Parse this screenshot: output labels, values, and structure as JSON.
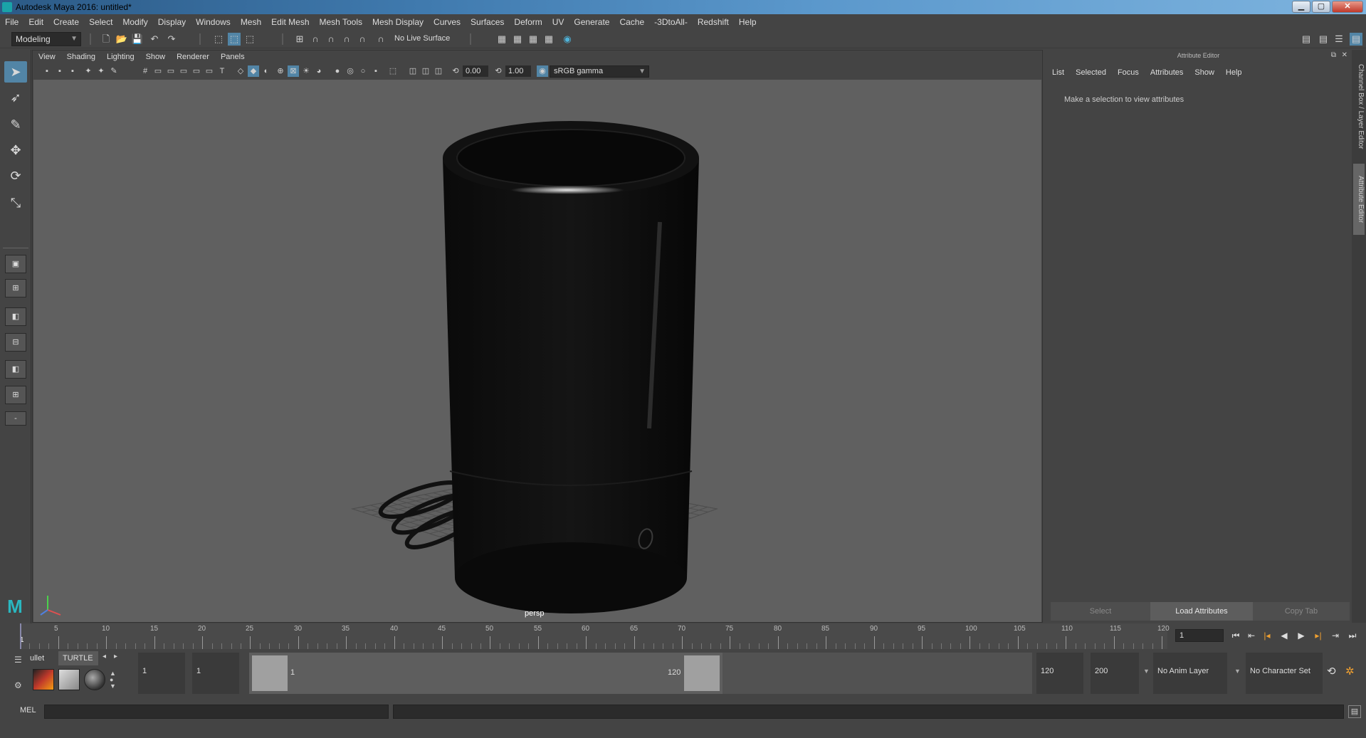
{
  "window": {
    "title": "Autodesk Maya 2016: untitled*",
    "minimize": "▁",
    "maximize": "▢",
    "close": "✕"
  },
  "menubar": [
    "File",
    "Edit",
    "Create",
    "Select",
    "Modify",
    "Display",
    "Windows",
    "Mesh",
    "Edit Mesh",
    "Mesh Tools",
    "Mesh Display",
    "Curves",
    "Surfaces",
    "Deform",
    "UV",
    "Generate",
    "Cache",
    "-3DtoAll-",
    "Redshift",
    "Help"
  ],
  "statusline": {
    "workspace": "Modeling",
    "live_surface": "No Live Surface"
  },
  "panel": {
    "menu": [
      "View",
      "Shading",
      "Lighting",
      "Show",
      "Renderer",
      "Panels"
    ],
    "exposure": "0.00",
    "gamma": "1.00",
    "color_space": "sRGB gamma",
    "camera": "persp"
  },
  "attribute_editor": {
    "title": "Attribute Editor",
    "menu": [
      "List",
      "Selected",
      "Focus",
      "Attributes",
      "Show",
      "Help"
    ],
    "message": "Make a selection to view attributes",
    "buttons": {
      "select": "Select",
      "load": "Load Attributes",
      "copy": "Copy Tab"
    }
  },
  "side_tabs": {
    "channel_box": "Channel Box / Layer Editor",
    "attribute_editor": "Attribute Editor"
  },
  "timeline": {
    "ticks": [
      "5",
      "10",
      "15",
      "20",
      "25",
      "30",
      "35",
      "40",
      "45",
      "50",
      "55",
      "60",
      "65",
      "70",
      "75",
      "80",
      "85",
      "90",
      "95",
      "100",
      "105",
      "110",
      "115",
      "120"
    ],
    "start_label": "1",
    "current_frame": "1"
  },
  "shelf": {
    "tabs": [
      "ullet",
      "TURTLE"
    ]
  },
  "range": {
    "start": "1",
    "playback_start": "1",
    "range_start_label": "1",
    "range_end_label": "120",
    "playback_end": "120",
    "end": "200",
    "anim_layer": "No Anim Layer",
    "character_set": "No Character Set"
  },
  "cmdline": {
    "label": "MEL"
  },
  "colors": {
    "accent": "#5285a6",
    "viewport_bg": "#606060"
  }
}
